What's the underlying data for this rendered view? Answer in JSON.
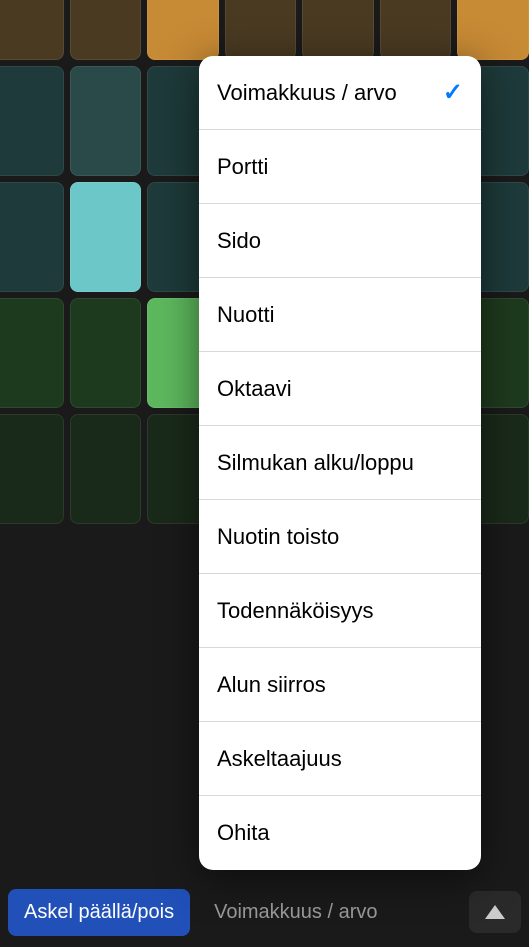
{
  "menu": {
    "items": [
      {
        "label": "Voimakkuus / arvo",
        "selected": true
      },
      {
        "label": "Portti",
        "selected": false
      },
      {
        "label": "Sido",
        "selected": false
      },
      {
        "label": "Nuotti",
        "selected": false
      },
      {
        "label": "Oktaavi",
        "selected": false
      },
      {
        "label": "Silmukan alku/loppu",
        "selected": false
      },
      {
        "label": "Nuotin toisto",
        "selected": false
      },
      {
        "label": "Todennäköisyys",
        "selected": false
      },
      {
        "label": "Alun siirros",
        "selected": false
      },
      {
        "label": "Askeltaajuus",
        "selected": false
      },
      {
        "label": "Ohita",
        "selected": false
      }
    ]
  },
  "bottomBar": {
    "stepToggle": "Askel päällä/pois",
    "currentMode": "Voimakkuus / arvo"
  }
}
